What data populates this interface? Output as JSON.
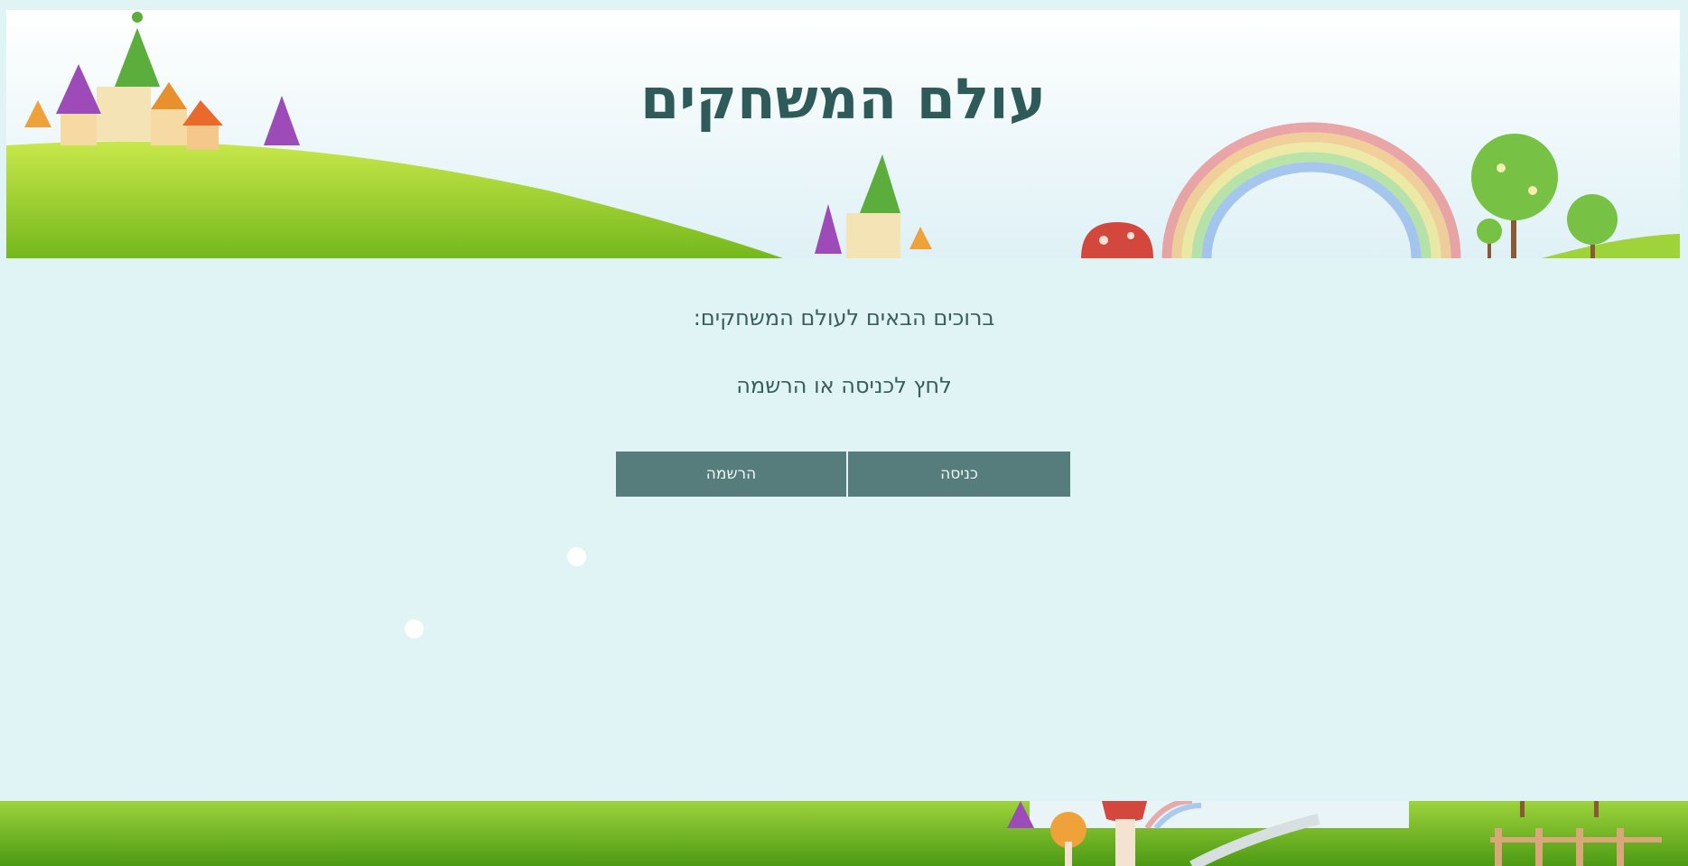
{
  "header": {
    "title": "עולם המשחקים"
  },
  "main": {
    "welcome_text": "ברוכים הבאים לעולם המשחקים:",
    "prompt_text": "לחץ לכניסה או הרשמה",
    "login_label": "כניסה",
    "register_label": "הרשמה"
  },
  "colors": {
    "page_background": "#e0f4f6",
    "title_color": "#2f5a5a",
    "button_background": "#567d7b",
    "button_text": "#eef6f6"
  },
  "icons": [
    "banner-image-castles-rainbow",
    "footer-image-grass-mushrooms"
  ]
}
